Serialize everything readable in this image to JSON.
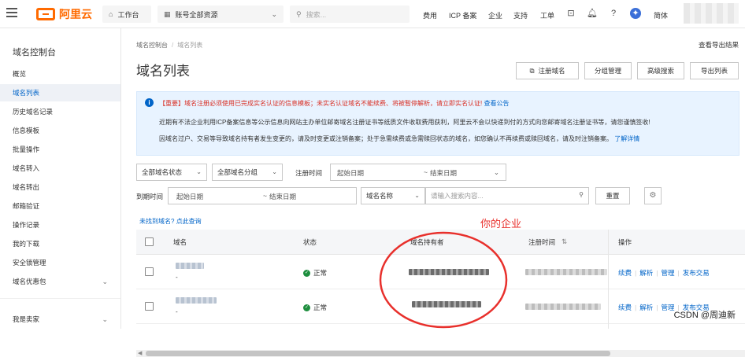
{
  "topbar": {
    "brand": "阿里云",
    "workbench": "工作台",
    "account_resources": "账号全部资源",
    "search_placeholder": "搜索...",
    "links": [
      "费用",
      "ICP 备案",
      "企业",
      "支持",
      "工单"
    ],
    "lang": "简体"
  },
  "sidebar": {
    "title": "域名控制台",
    "items": [
      {
        "label": "概览"
      },
      {
        "label": "域名列表"
      },
      {
        "label": "历史域名记录"
      },
      {
        "label": "信息模板"
      },
      {
        "label": "批量操作"
      },
      {
        "label": "域名转入"
      },
      {
        "label": "域名转出"
      },
      {
        "label": "邮箱验证"
      },
      {
        "label": "操作记录"
      },
      {
        "label": "我的下载"
      },
      {
        "label": "安全锁管理"
      },
      {
        "label": "域名优惠包"
      },
      {
        "label": "我是卖家"
      }
    ]
  },
  "breadcrumb": {
    "root": "域名控制台",
    "current": "域名列表"
  },
  "export_results": "查看导出结果",
  "page_title": "域名列表",
  "header_buttons": {
    "register": "注册域名",
    "group": "分组管理",
    "advanced": "高级搜索",
    "export": "导出列表"
  },
  "notice": {
    "tag": "【重要】",
    "line1_red": "域名注册必须使用已完成实名认证的信息模板；未实名认证域名不能续费、将被暂停解析，请立即实名认证!",
    "line1_link": "查看公告",
    "line2": "近期有不法企业利用ICP备案信息等公示信息向网站主办单位邮寄域名注册证书等纸质文件收取费用获利，阿里云不会以快递到付的方式向您邮寄域名注册证书等，请您谨慎签收!",
    "line3": "因域名过户、交易等导致域名持有者发生变更的，请及时变更或注销备案；处于急需续费或急需赎回状态的域名，如您确认不再续费或赎回域名，请及时注销备案。",
    "line3_link": "了解详情"
  },
  "filters": {
    "all_status": "全部域名状态",
    "all_groups": "全部域名分组",
    "reg_time_label": "注册时间",
    "start_date": "起始日期",
    "tilde": "~",
    "end_date": "结束日期",
    "expire_label": "到期时间",
    "field_select": "域名名称",
    "search_placeholder": "请输入搜索内容...",
    "reset": "重置"
  },
  "not_found_link": "未找到域名? 点此查询",
  "annotation": "你的企业",
  "table": {
    "columns": {
      "domain": "域名",
      "status": "状态",
      "holder": "域名持有者",
      "reg_time": "注册时间",
      "sort": "⇅",
      "actions": "操作"
    },
    "rows": [
      {
        "sub": "-",
        "status": "正常"
      },
      {
        "sub": "-",
        "status": "正常"
      }
    ],
    "actions": [
      "续费",
      "解析",
      "管理",
      "发布交易"
    ]
  },
  "watermark": "CSDN @周迪新"
}
